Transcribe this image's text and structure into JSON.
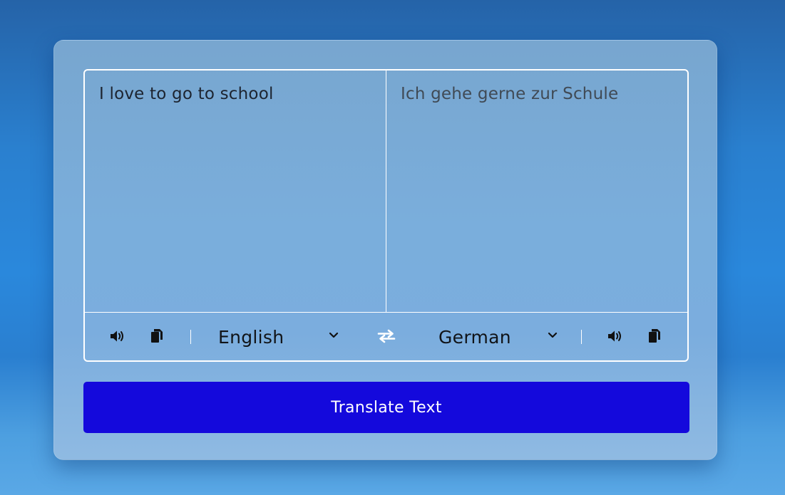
{
  "source": {
    "text": "I love to go to school",
    "language": "English"
  },
  "target": {
    "text": "Ich gehe gerne zur Schule",
    "language": "German"
  },
  "icons": {
    "speak_source": "speaker-icon",
    "copy_source": "copy-icon",
    "swap": "swap-arrows-icon",
    "speak_target": "speaker-icon",
    "copy_target": "copy-icon",
    "dropdown": "chevron-down-icon"
  },
  "actions": {
    "translate_label": "Translate Text"
  },
  "colors": {
    "button_bg": "#1409dc",
    "panel_border": "#ffffff"
  }
}
